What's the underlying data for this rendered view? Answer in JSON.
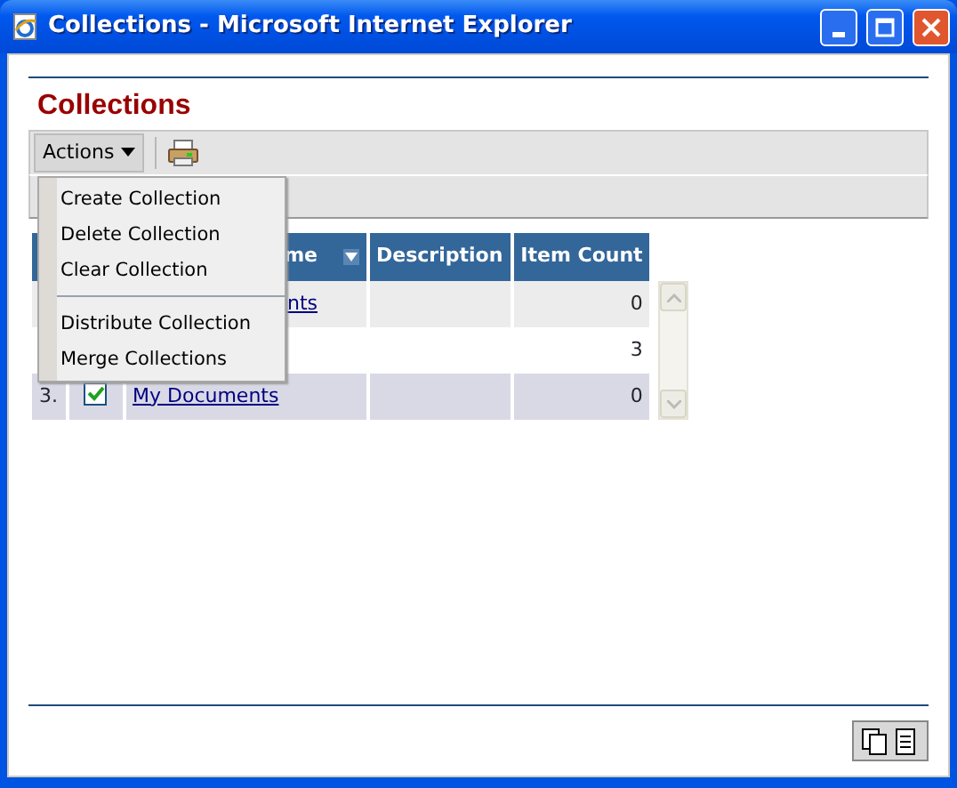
{
  "window": {
    "title": "Collections - Microsoft Internet Explorer"
  },
  "heading": "Collections",
  "toolbar": {
    "actions_label": "Actions"
  },
  "menu": {
    "groups": [
      [
        "Create Collection",
        "Delete Collection",
        "Clear Collection"
      ],
      [
        "Distribute Collection",
        "Merge Collections"
      ]
    ]
  },
  "table": {
    "columns": [
      "me",
      "Description",
      "Item Count"
    ],
    "rows": [
      {
        "name": "nts",
        "item_count": "0"
      },
      {
        "item_count": "3"
      },
      {
        "index": "3.",
        "checked": true,
        "name": "My Documents",
        "item_count": "0"
      }
    ]
  }
}
